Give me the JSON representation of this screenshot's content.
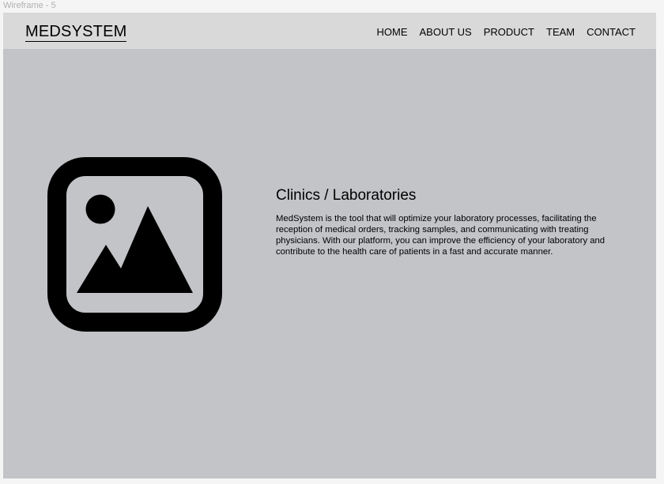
{
  "frame": {
    "label": "Wireframe - 5"
  },
  "header": {
    "logo": "MEDSYSTEM",
    "nav": [
      {
        "label": "HOME"
      },
      {
        "label": "ABOUT US"
      },
      {
        "label": "PRODUCT"
      },
      {
        "label": "TEAM"
      },
      {
        "label": "CONTACT"
      }
    ]
  },
  "main": {
    "image_icon": "image-placeholder-icon",
    "title": "Clinics / Laboratories",
    "description": "MedSystem is the tool that will optimize your laboratory processes, facilitating the reception of medical orders, tracking samples, and communicating with treating physicians. With our platform, you can improve the efficiency of your laboratory and contribute to the health care of patients in a fast and accurate manner."
  },
  "colors": {
    "page_bg": "#c3c4c8",
    "header_bg": "#d9d9d9",
    "text": "#000000"
  }
}
